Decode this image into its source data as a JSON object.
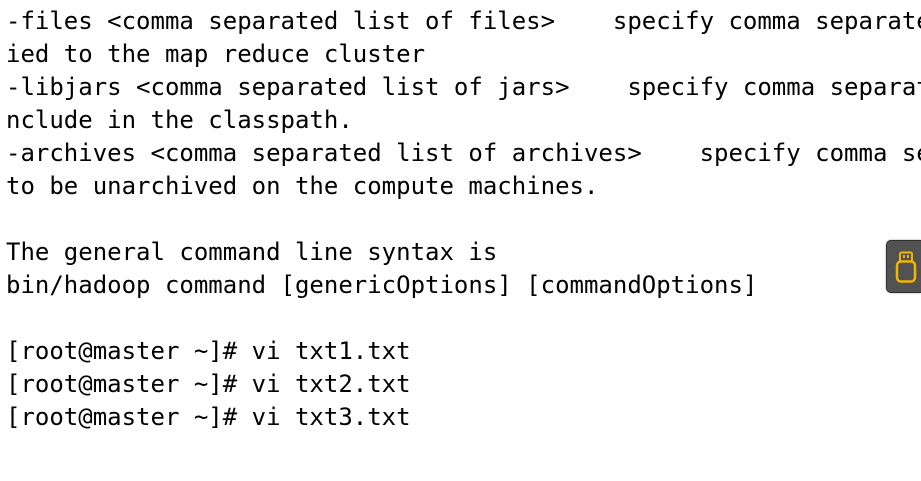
{
  "terminal": {
    "lines": [
      "-files <comma separated list of files>    specify comma separated files to be cop",
      "ied to the map reduce cluster",
      "-libjars <comma separated list of jars>    specify comma separated jar files to i",
      "nclude in the classpath.",
      "-archives <comma separated list of archives>    specify comma separated archives",
      "to be unarchived on the compute machines.",
      "",
      "The general command line syntax is",
      "bin/hadoop command [genericOptions] [commandOptions]",
      "",
      "[root@master ~]# vi txt1.txt",
      "[root@master ~]# vi txt2.txt",
      "[root@master ~]# vi txt3.txt"
    ]
  },
  "floating_tool": {
    "icon": "usb-drive-icon",
    "colors": {
      "background": "#525252",
      "icon": "#f2b500"
    }
  }
}
